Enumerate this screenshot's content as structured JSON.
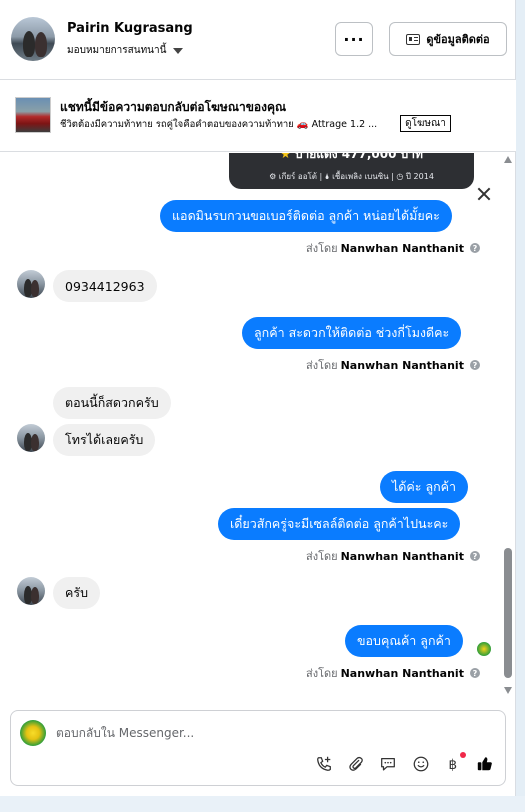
{
  "header": {
    "name": "Pairin Kugrasang",
    "assign_label": "มอบหมายการสนทนานี้",
    "more_label": "···",
    "contact_info_label": "ดูข้อมูลติดต่อ"
  },
  "ad_banner": {
    "title": "แชทนี้มีข้อความตอบกลับต่อโฆษณาของคุณ",
    "description": "ชีวิตต้องมีความท้าทาย รถคู่ใจคือคำตอบของความท้าทาย 🚗 Attrage 1.2 ...",
    "view_ad_label": "ดูโฆษณา"
  },
  "car_card": {
    "price": "ป้ายแดง 477,000 บาท",
    "specs": "⚙ เกียร์ ออโต้  |  🌢 เชื้อเพลิง เบนซิน  |  ◷ ปี 2014"
  },
  "messages": [
    {
      "text": "แอดมินรบกวนขอเบอร์ติดต่อ ลูกค้า  หน่อยได้มั้ยคะ"
    },
    {
      "text": "0934412963"
    },
    {
      "text": "ลูกค้า สะดวกให้ติดต่อ ช่วงกี่โมงดีคะ"
    },
    {
      "text": "ตอนนี้ก็สดวกครับ"
    },
    {
      "text": "โทรได้เลยครับ"
    },
    {
      "text": "ได้ค่ะ  ลูกค้า"
    },
    {
      "text": "เดี๋ยวสักครู่จะมีเซลล์ติดต่อ ลูกค้าไปนะคะ"
    },
    {
      "text": "ครับ"
    },
    {
      "text": "ขอบคุณค้า ลูกค้า"
    }
  ],
  "sent_by": {
    "prefix": "ส่งโดย",
    "name": "Nanwhan Nanthanit"
  },
  "composer": {
    "placeholder": "ตอบกลับใน Messenger..."
  },
  "colors": {
    "outgoing_bubble": "#0a7cff",
    "incoming_bubble": "#f0f0f0",
    "like_button": "#050505"
  },
  "icons": [
    "more-icon",
    "id-card-icon",
    "close-icon",
    "call-add-icon",
    "attach-icon",
    "saved-reply-icon",
    "emoji-icon",
    "baht-icon",
    "like-icon"
  ]
}
